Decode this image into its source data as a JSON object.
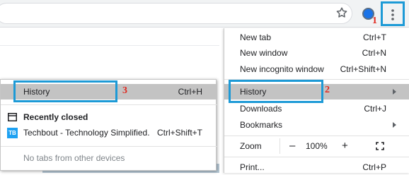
{
  "menu": {
    "items": [
      {
        "label": "New tab",
        "shortcut": "Ctrl+T"
      },
      {
        "label": "New window",
        "shortcut": "Ctrl+N"
      },
      {
        "label": "New incognito window",
        "shortcut": "Ctrl+Shift+N"
      },
      {
        "label": "History",
        "shortcut": ""
      },
      {
        "label": "Downloads",
        "shortcut": "Ctrl+J"
      },
      {
        "label": "Bookmarks",
        "shortcut": ""
      },
      {
        "label": "Zoom",
        "shortcut": ""
      },
      {
        "label": "Print...",
        "shortcut": "Ctrl+P"
      }
    ],
    "zoom": {
      "minus": "–",
      "value": "100%",
      "plus": "+"
    }
  },
  "history_submenu": {
    "history_label": "History",
    "history_shortcut": "Ctrl+H",
    "recently_closed_label": "Recently closed",
    "tab_item": {
      "favicon_text": "TB",
      "label": "Techbout - Technology Simplified.",
      "shortcut": "Ctrl+Shift+T"
    },
    "no_tabs_text": "No tabs from other devices"
  },
  "callouts": {
    "one": "1",
    "two": "2",
    "three": "3"
  },
  "colors": {
    "highlight": "#c3c3c3",
    "callout_border": "#1d9ad6",
    "callout_number": "#e0281e",
    "favicon": "#1da1f2"
  }
}
